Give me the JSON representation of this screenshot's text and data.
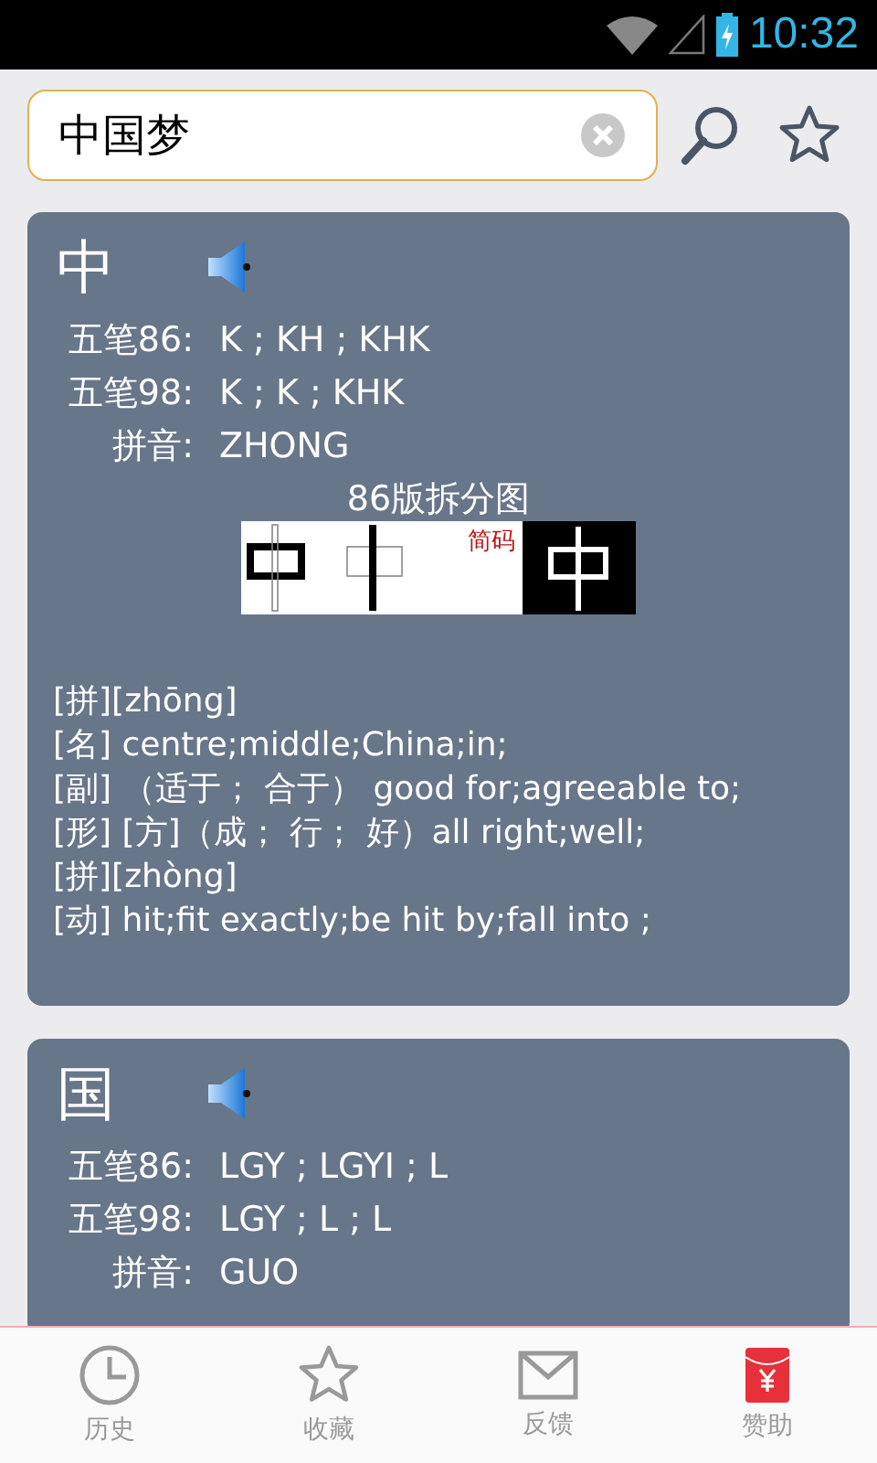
{
  "status_bar": {
    "time": "10:32"
  },
  "search": {
    "value": "中国梦"
  },
  "entries": [
    {
      "character": "中",
      "codes": [
        {
          "label": "五笔86:",
          "value": "K ; KH ; KHK"
        },
        {
          "label": "五笔98:",
          "value": "K ; K ; KHK"
        },
        {
          "label": "拼音:",
          "value": "ZHONG"
        }
      ],
      "diagram": {
        "title": "86版拆分图",
        "note": "简码"
      },
      "definitions": [
        "[拼][zhōng]",
        "[名] centre;middle;China;in;",
        "[副] （适于； 合于） good for;agreeable to;",
        "[形] [方]（成； 行； 好）all right;well;",
        "[拼][zhòng]",
        "[动] hit;fit exactly;be hit by;fall into ;"
      ]
    },
    {
      "character": "国",
      "codes": [
        {
          "label": "五笔86:",
          "value": "LGY ; LGYI ; L"
        },
        {
          "label": "五笔98:",
          "value": "LGY ; L ; L"
        },
        {
          "label": "拼音:",
          "value": "GUO"
        }
      ]
    }
  ],
  "tabs": [
    {
      "label": "历史",
      "kind": "history"
    },
    {
      "label": "收藏",
      "kind": "favorites"
    },
    {
      "label": "反馈",
      "kind": "feedback"
    },
    {
      "label": "赞助",
      "kind": "donate"
    }
  ]
}
